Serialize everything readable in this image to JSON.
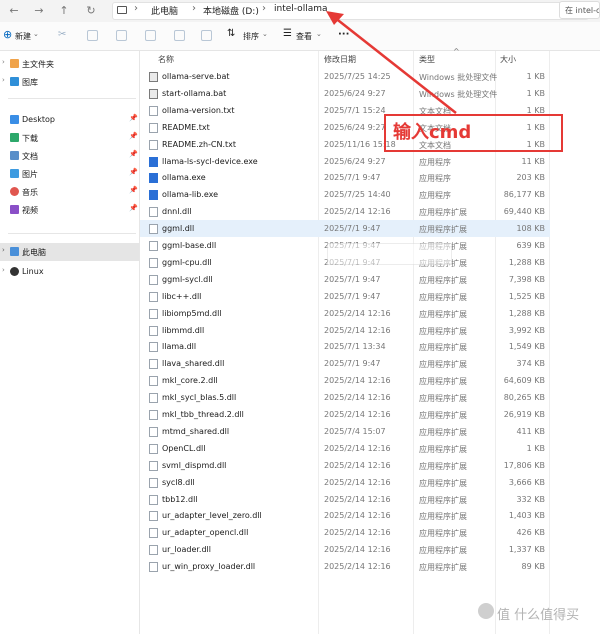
{
  "address_bar": {
    "breadcrumbs": [
      "此电脑",
      "本地磁盘 (D:)",
      "intel-ollama"
    ],
    "search_placeholder": "在 intel-c"
  },
  "toolbar": {
    "new_label": "新建",
    "sort_label": "排序",
    "view_label": "查看",
    "more_label": "···"
  },
  "sidebar": {
    "items": [
      {
        "label": "主文件夹",
        "icon": "home-icon",
        "pin": ""
      },
      {
        "label": "图库",
        "icon": "gallery-icon",
        "pin": ""
      },
      {
        "label": "Desktop",
        "icon": "desktop-icon",
        "pin": "📌"
      },
      {
        "label": "下载",
        "icon": "download-icon",
        "pin": "📌"
      },
      {
        "label": "文档",
        "icon": "documents-icon",
        "pin": "📌"
      },
      {
        "label": "图片",
        "icon": "pictures-icon",
        "pin": "📌"
      },
      {
        "label": "音乐",
        "icon": "music-icon",
        "pin": "📌"
      },
      {
        "label": "视频",
        "icon": "videos-icon",
        "pin": "📌"
      },
      {
        "label": "此电脑",
        "icon": "this-pc-icon",
        "pin": ""
      },
      {
        "label": "Linux",
        "icon": "linux-icon",
        "pin": ""
      }
    ]
  },
  "columns": {
    "name": "名称",
    "date": "修改日期",
    "type": "类型",
    "size": "大小"
  },
  "files": [
    {
      "name": "ollama-serve.bat",
      "date": "2025/7/25 14:25",
      "type": "Windows 批处理文件",
      "size": "1 KB",
      "kind": "bat"
    },
    {
      "name": "start-ollama.bat",
      "date": "2025/6/24 9:27",
      "type": "Windows 批处理文件",
      "size": "1 KB",
      "kind": "bat"
    },
    {
      "name": "ollama-version.txt",
      "date": "2025/7/1 15:24",
      "type": "文本文档",
      "size": "1 KB",
      "kind": "txt"
    },
    {
      "name": "README.txt",
      "date": "2025/6/24 9:27",
      "type": "文本文档",
      "size": "1 KB",
      "kind": "txt"
    },
    {
      "name": "README.zh-CN.txt",
      "date": "2025/11/16 15:18",
      "type": "文本文档",
      "size": "1 KB",
      "kind": "txt"
    },
    {
      "name": "llama-ls-sycl-device.exe",
      "date": "2025/6/24 9:27",
      "type": "应用程序",
      "size": "11 KB",
      "kind": "exe"
    },
    {
      "name": "ollama.exe",
      "date": "2025/7/1 9:47",
      "type": "应用程序",
      "size": "203 KB",
      "kind": "exe"
    },
    {
      "name": "ollama-lib.exe",
      "date": "2025/7/25 14:40",
      "type": "应用程序",
      "size": "86,177 KB",
      "kind": "exe"
    },
    {
      "name": "dnnl.dll",
      "date": "2025/2/14 12:16",
      "type": "应用程序扩展",
      "size": "69,440 KB",
      "kind": "dll"
    },
    {
      "name": "ggml.dll",
      "date": "2025/7/1 9:47",
      "type": "应用程序扩展",
      "size": "108 KB",
      "kind": "dll"
    },
    {
      "name": "ggml-base.dll",
      "date": "2025/7/1 9:47",
      "type": "应用程序扩展",
      "size": "639 KB",
      "kind": "dll"
    },
    {
      "name": "ggml-cpu.dll",
      "date": "2025/7/1 9:47",
      "type": "应用程序扩展",
      "size": "1,288 KB",
      "kind": "dll"
    },
    {
      "name": "ggml-sycl.dll",
      "date": "2025/7/1 9:47",
      "type": "应用程序扩展",
      "size": "7,398 KB",
      "kind": "dll"
    },
    {
      "name": "libc++.dll",
      "date": "2025/7/1 9:47",
      "type": "应用程序扩展",
      "size": "1,525 KB",
      "kind": "dll"
    },
    {
      "name": "libiomp5md.dll",
      "date": "2025/2/14 12:16",
      "type": "应用程序扩展",
      "size": "1,288 KB",
      "kind": "dll"
    },
    {
      "name": "libmmd.dll",
      "date": "2025/2/14 12:16",
      "type": "应用程序扩展",
      "size": "3,992 KB",
      "kind": "dll"
    },
    {
      "name": "llama.dll",
      "date": "2025/7/1 13:34",
      "type": "应用程序扩展",
      "size": "1,549 KB",
      "kind": "dll"
    },
    {
      "name": "llava_shared.dll",
      "date": "2025/7/1 9:47",
      "type": "应用程序扩展",
      "size": "374 KB",
      "kind": "dll"
    },
    {
      "name": "mkl_core.2.dll",
      "date": "2025/2/14 12:16",
      "type": "应用程序扩展",
      "size": "64,609 KB",
      "kind": "dll"
    },
    {
      "name": "mkl_sycl_blas.5.dll",
      "date": "2025/2/14 12:16",
      "type": "应用程序扩展",
      "size": "80,265 KB",
      "kind": "dll"
    },
    {
      "name": "mkl_tbb_thread.2.dll",
      "date": "2025/2/14 12:16",
      "type": "应用程序扩展",
      "size": "26,919 KB",
      "kind": "dll"
    },
    {
      "name": "mtmd_shared.dll",
      "date": "2025/7/4 15:07",
      "type": "应用程序扩展",
      "size": "411 KB",
      "kind": "dll"
    },
    {
      "name": "OpenCL.dll",
      "date": "2025/2/14 12:16",
      "type": "应用程序扩展",
      "size": "1 KB",
      "kind": "dll"
    },
    {
      "name": "svml_dispmd.dll",
      "date": "2025/2/14 12:16",
      "type": "应用程序扩展",
      "size": "17,806 KB",
      "kind": "dll"
    },
    {
      "name": "sycl8.dll",
      "date": "2025/2/14 12:16",
      "type": "应用程序扩展",
      "size": "3,666 KB",
      "kind": "dll"
    },
    {
      "name": "tbb12.dll",
      "date": "2025/2/14 12:16",
      "type": "应用程序扩展",
      "size": "332 KB",
      "kind": "dll"
    },
    {
      "name": "ur_adapter_level_zero.dll",
      "date": "2025/2/14 12:16",
      "type": "应用程序扩展",
      "size": "1,403 KB",
      "kind": "dll"
    },
    {
      "name": "ur_adapter_opencl.dll",
      "date": "2025/2/14 12:16",
      "type": "应用程序扩展",
      "size": "426 KB",
      "kind": "dll"
    },
    {
      "name": "ur_loader.dll",
      "date": "2025/2/14 12:16",
      "type": "应用程序扩展",
      "size": "1,337 KB",
      "kind": "dll"
    },
    {
      "name": "ur_win_proxy_loader.dll",
      "date": "2025/2/14 12:16",
      "type": "应用程序扩展",
      "size": "89 KB",
      "kind": "dll"
    }
  ],
  "selected_file": "ggml.dll",
  "tooltip_text": "",
  "annotation": {
    "text": "输入cmd",
    "color": "#e53935"
  },
  "watermark": "值 什么值得买",
  "colors": {
    "accent": "#0067c0",
    "selection": "#e5f0fb",
    "annotation_red": "#e53935"
  }
}
